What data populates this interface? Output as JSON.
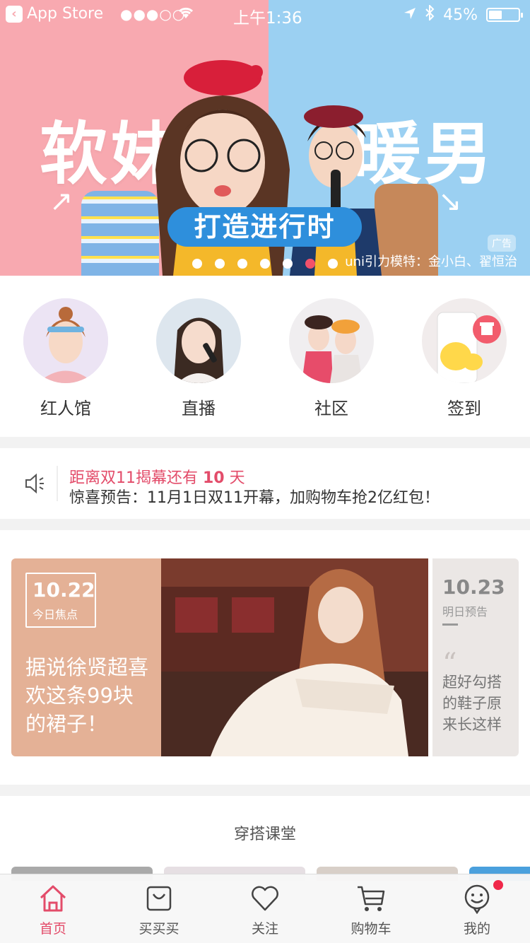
{
  "status_bar": {
    "back_app": "App Store",
    "signal": "●●●○○",
    "time": "上午1:36",
    "battery": "45%"
  },
  "banner": {
    "left_title": "软妹",
    "right_title": "暖男",
    "pill_text": "打造进行时",
    "ad_tag": "广告",
    "credit": "uni引力模特：金小白、翟恒治",
    "dot_count": 7,
    "active_dot": 5
  },
  "quick_nav": [
    {
      "label": "红人馆"
    },
    {
      "label": "直播"
    },
    {
      "label": "社区"
    },
    {
      "label": "签到"
    }
  ],
  "notice": {
    "line1_prefix": "距离双11揭幕还有 ",
    "days": "10",
    "line1_suffix": " 天",
    "line2": "惊喜预告：11月1日双11开幕，加购物车抢2亿红包！"
  },
  "daily_card": {
    "today_date": "10.22",
    "today_label": "今日焦点",
    "today_text": "据说徐贤超喜欢这条99块的裙子！",
    "tomorrow_date": "10.23",
    "tomorrow_label": "明日预告",
    "tomorrow_text": "超好勾搭的鞋子原来长这样"
  },
  "outfit_section": {
    "title": "穿搭课堂"
  },
  "tabbar": [
    {
      "label": "首页",
      "icon": "home-icon",
      "active": true
    },
    {
      "label": "买买买",
      "icon": "bag-icon",
      "active": false
    },
    {
      "label": "关注",
      "icon": "heart-icon",
      "active": false
    },
    {
      "label": "购物车",
      "icon": "cart-icon",
      "active": false
    },
    {
      "label": "我的",
      "icon": "face-icon",
      "active": false,
      "badge": true
    }
  ],
  "colors": {
    "accent": "#e34c6a",
    "banner_left": "#f8a9b0",
    "banner_right": "#9bd0f2"
  }
}
